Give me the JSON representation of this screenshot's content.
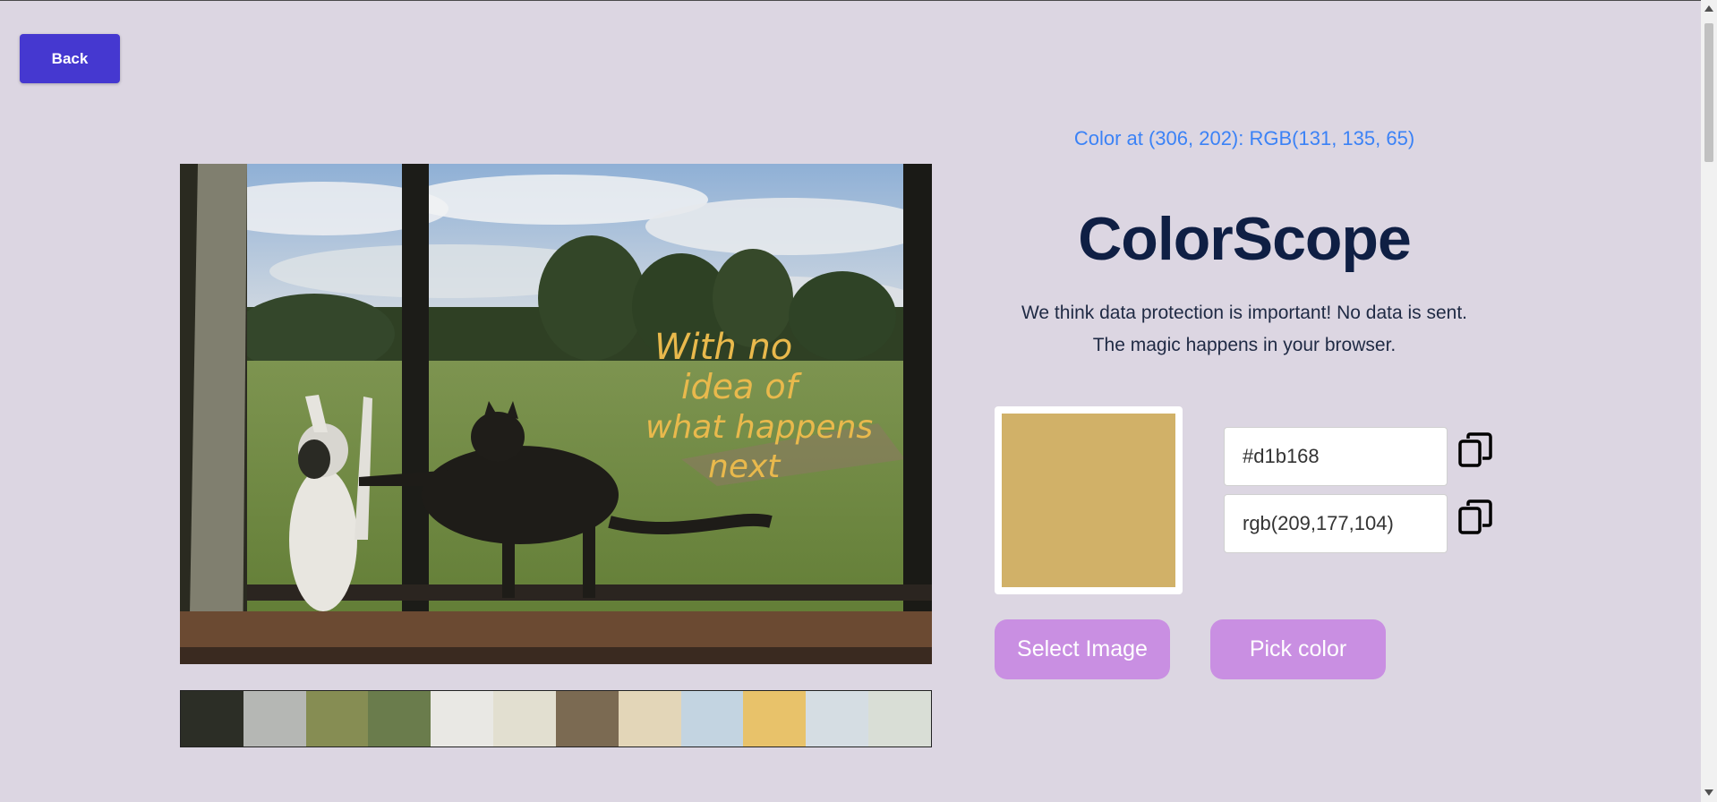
{
  "nav": {
    "back_label": "Back"
  },
  "readout": {
    "text": "Color at (306, 202): RGB(131, 135, 65)"
  },
  "header": {
    "title": "ColorScope",
    "privacy_line1": "We think data protection is important! No data is sent.",
    "privacy_line2": "The magic happens in your browser."
  },
  "selected_color": {
    "hex": "#d1b168",
    "rgb": "rgb(209,177,104)",
    "swatch": "#d1b168"
  },
  "photo": {
    "handwritten_text": [
      "With no",
      "idea of",
      "what happens",
      "next"
    ]
  },
  "palette": [
    {
      "color": "#2c2e26"
    },
    {
      "color": "#b5b7b4"
    },
    {
      "color": "#868d53"
    },
    {
      "color": "#6a7c4c"
    },
    {
      "color": "#e9e8e4"
    },
    {
      "color": "#e2dfd0"
    },
    {
      "color": "#7b6a52"
    },
    {
      "color": "#e3d6b8"
    },
    {
      "color": "#c3d4e1"
    },
    {
      "color": "#e8c26a"
    },
    {
      "color": "#d5dde3"
    },
    {
      "color": "#d9ded6"
    }
  ],
  "actions": {
    "select_image_label": "Select Image",
    "pick_color_label": "Pick color"
  },
  "colors": {
    "accent": "#4538d0",
    "button_purple": "#c98fe2",
    "readout_blue": "#3b82f6",
    "title_navy": "#0f1f44",
    "background": "#dcd6e2"
  },
  "icons": {
    "hex_copy": "copy-icon",
    "rgb_copy": "copy-icon"
  }
}
